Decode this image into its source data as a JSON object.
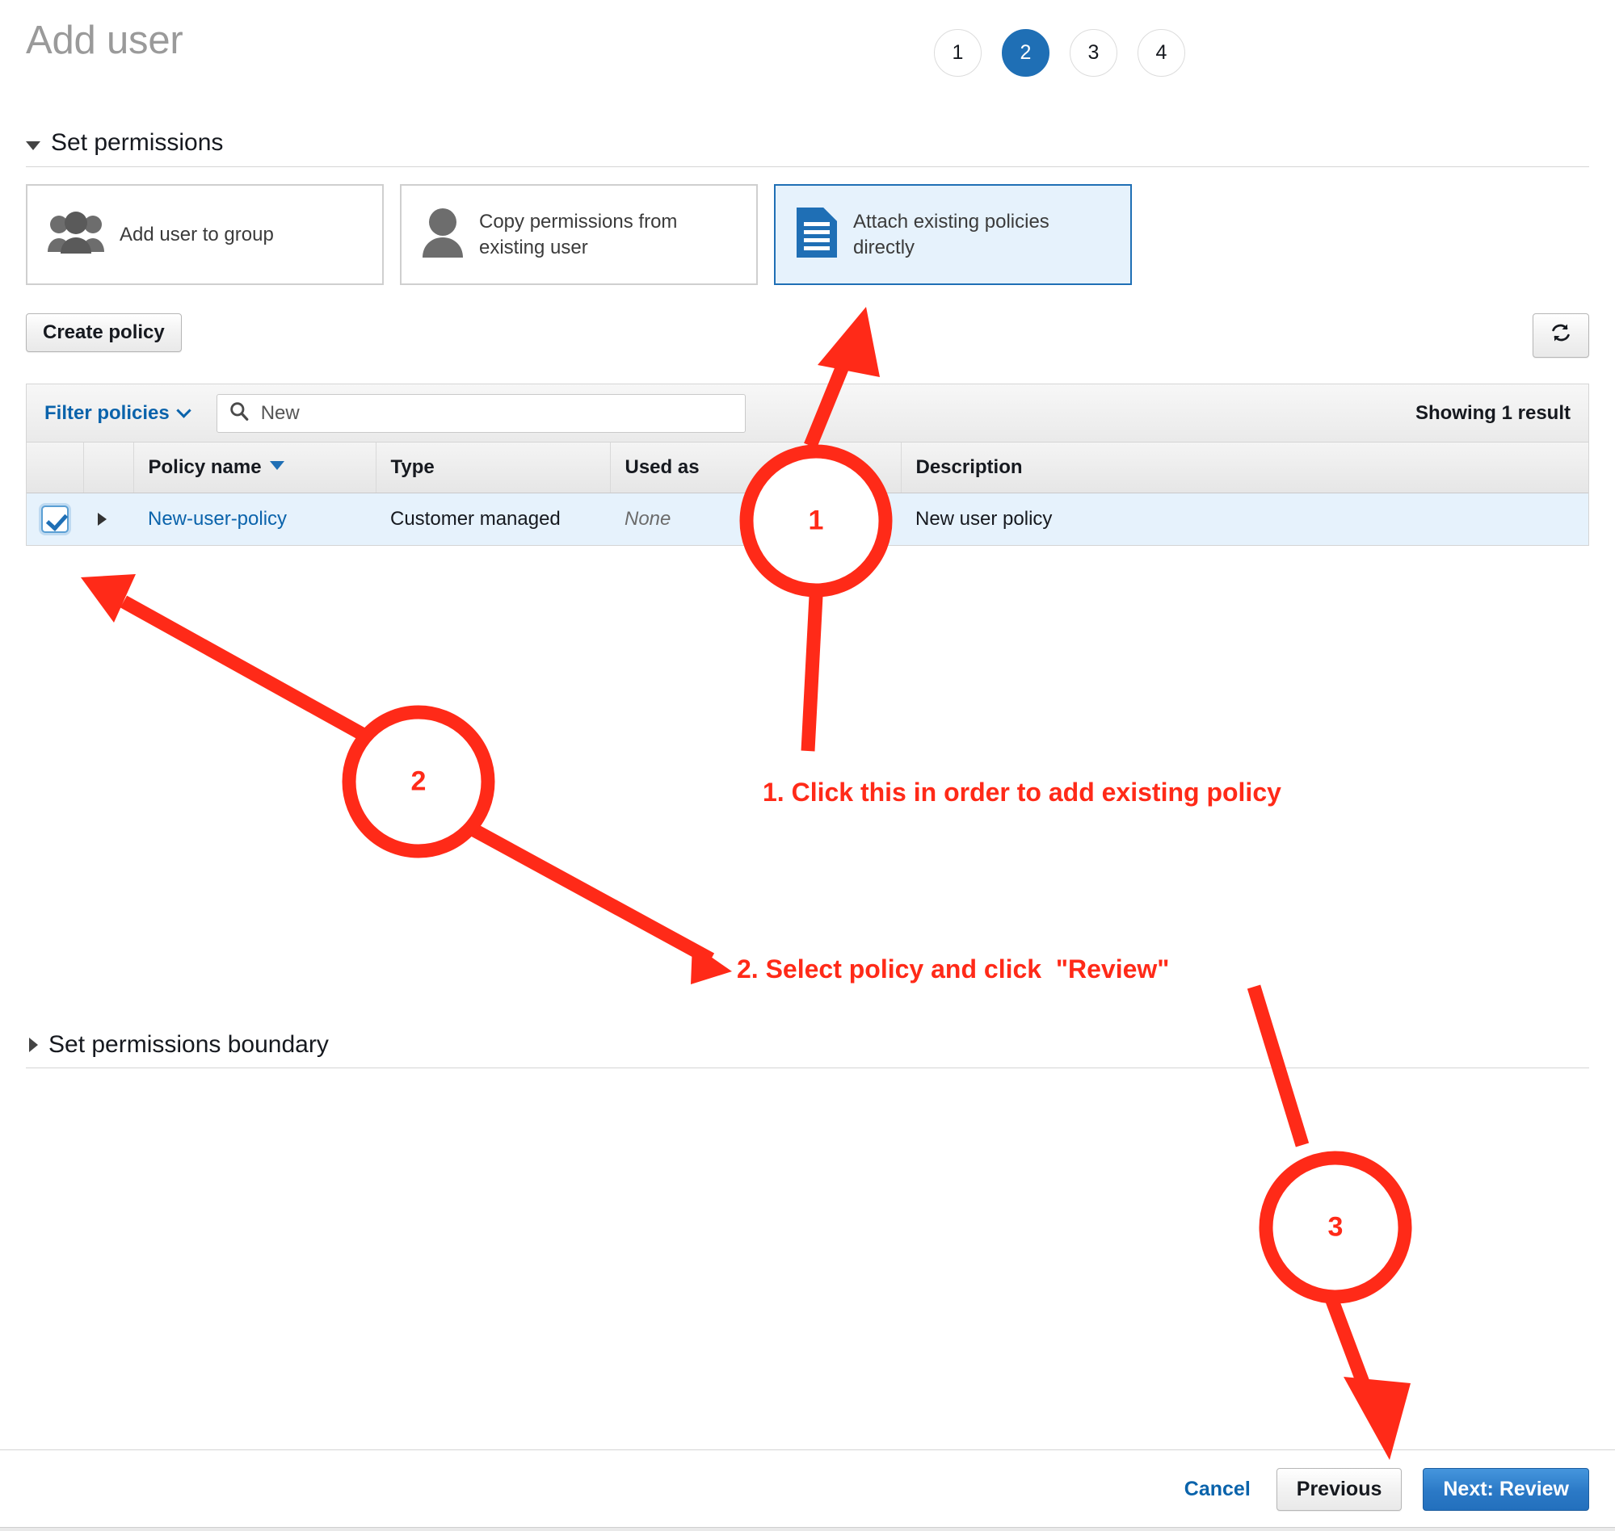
{
  "header": {
    "title": "Add user",
    "steps": [
      {
        "label": "1",
        "active": false
      },
      {
        "label": "2",
        "active": true
      },
      {
        "label": "3",
        "active": false
      },
      {
        "label": "4",
        "active": false
      }
    ]
  },
  "sections": {
    "set_permissions": "Set permissions",
    "set_permissions_boundary": "Set permissions boundary"
  },
  "cards": [
    {
      "label": "Add user to group",
      "icon": "users-group-icon",
      "selected": false
    },
    {
      "label": "Copy permissions from existing user",
      "icon": "user-icon",
      "selected": false
    },
    {
      "label": "Attach existing policies directly",
      "icon": "document-icon",
      "selected": true
    }
  ],
  "toolbar": {
    "create_policy": "Create policy",
    "refresh_icon": "refresh-icon"
  },
  "filter_bar": {
    "filter_link": "Filter policies",
    "search_value": "New",
    "search_placeholder": "Search",
    "search_icon": "search-icon",
    "showing": "Showing 1 result"
  },
  "table": {
    "columns": [
      "",
      "",
      "Policy name",
      "Type",
      "Used as",
      "Description"
    ],
    "sorted_column": "Policy name",
    "rows": [
      {
        "checked": true,
        "name": "New-user-policy",
        "type": "Customer managed",
        "used_as": "None",
        "description": "New user policy"
      }
    ]
  },
  "footer": {
    "cancel": "Cancel",
    "previous": "Previous",
    "next": "Next: Review"
  },
  "annotations": {
    "accent_color": "#ff2a18",
    "step1_text": "1. Click this in order to add existing policy",
    "step2_text": "2. Select policy and click  \"Review\"",
    "marker1": "1",
    "marker2": "2",
    "marker3": "3"
  },
  "colors": {
    "accent_blue": "#1f6fb5",
    "link_blue": "#0a63ab",
    "selected_row": "#e6f2fc",
    "annotation_red": "#ff2a18"
  }
}
